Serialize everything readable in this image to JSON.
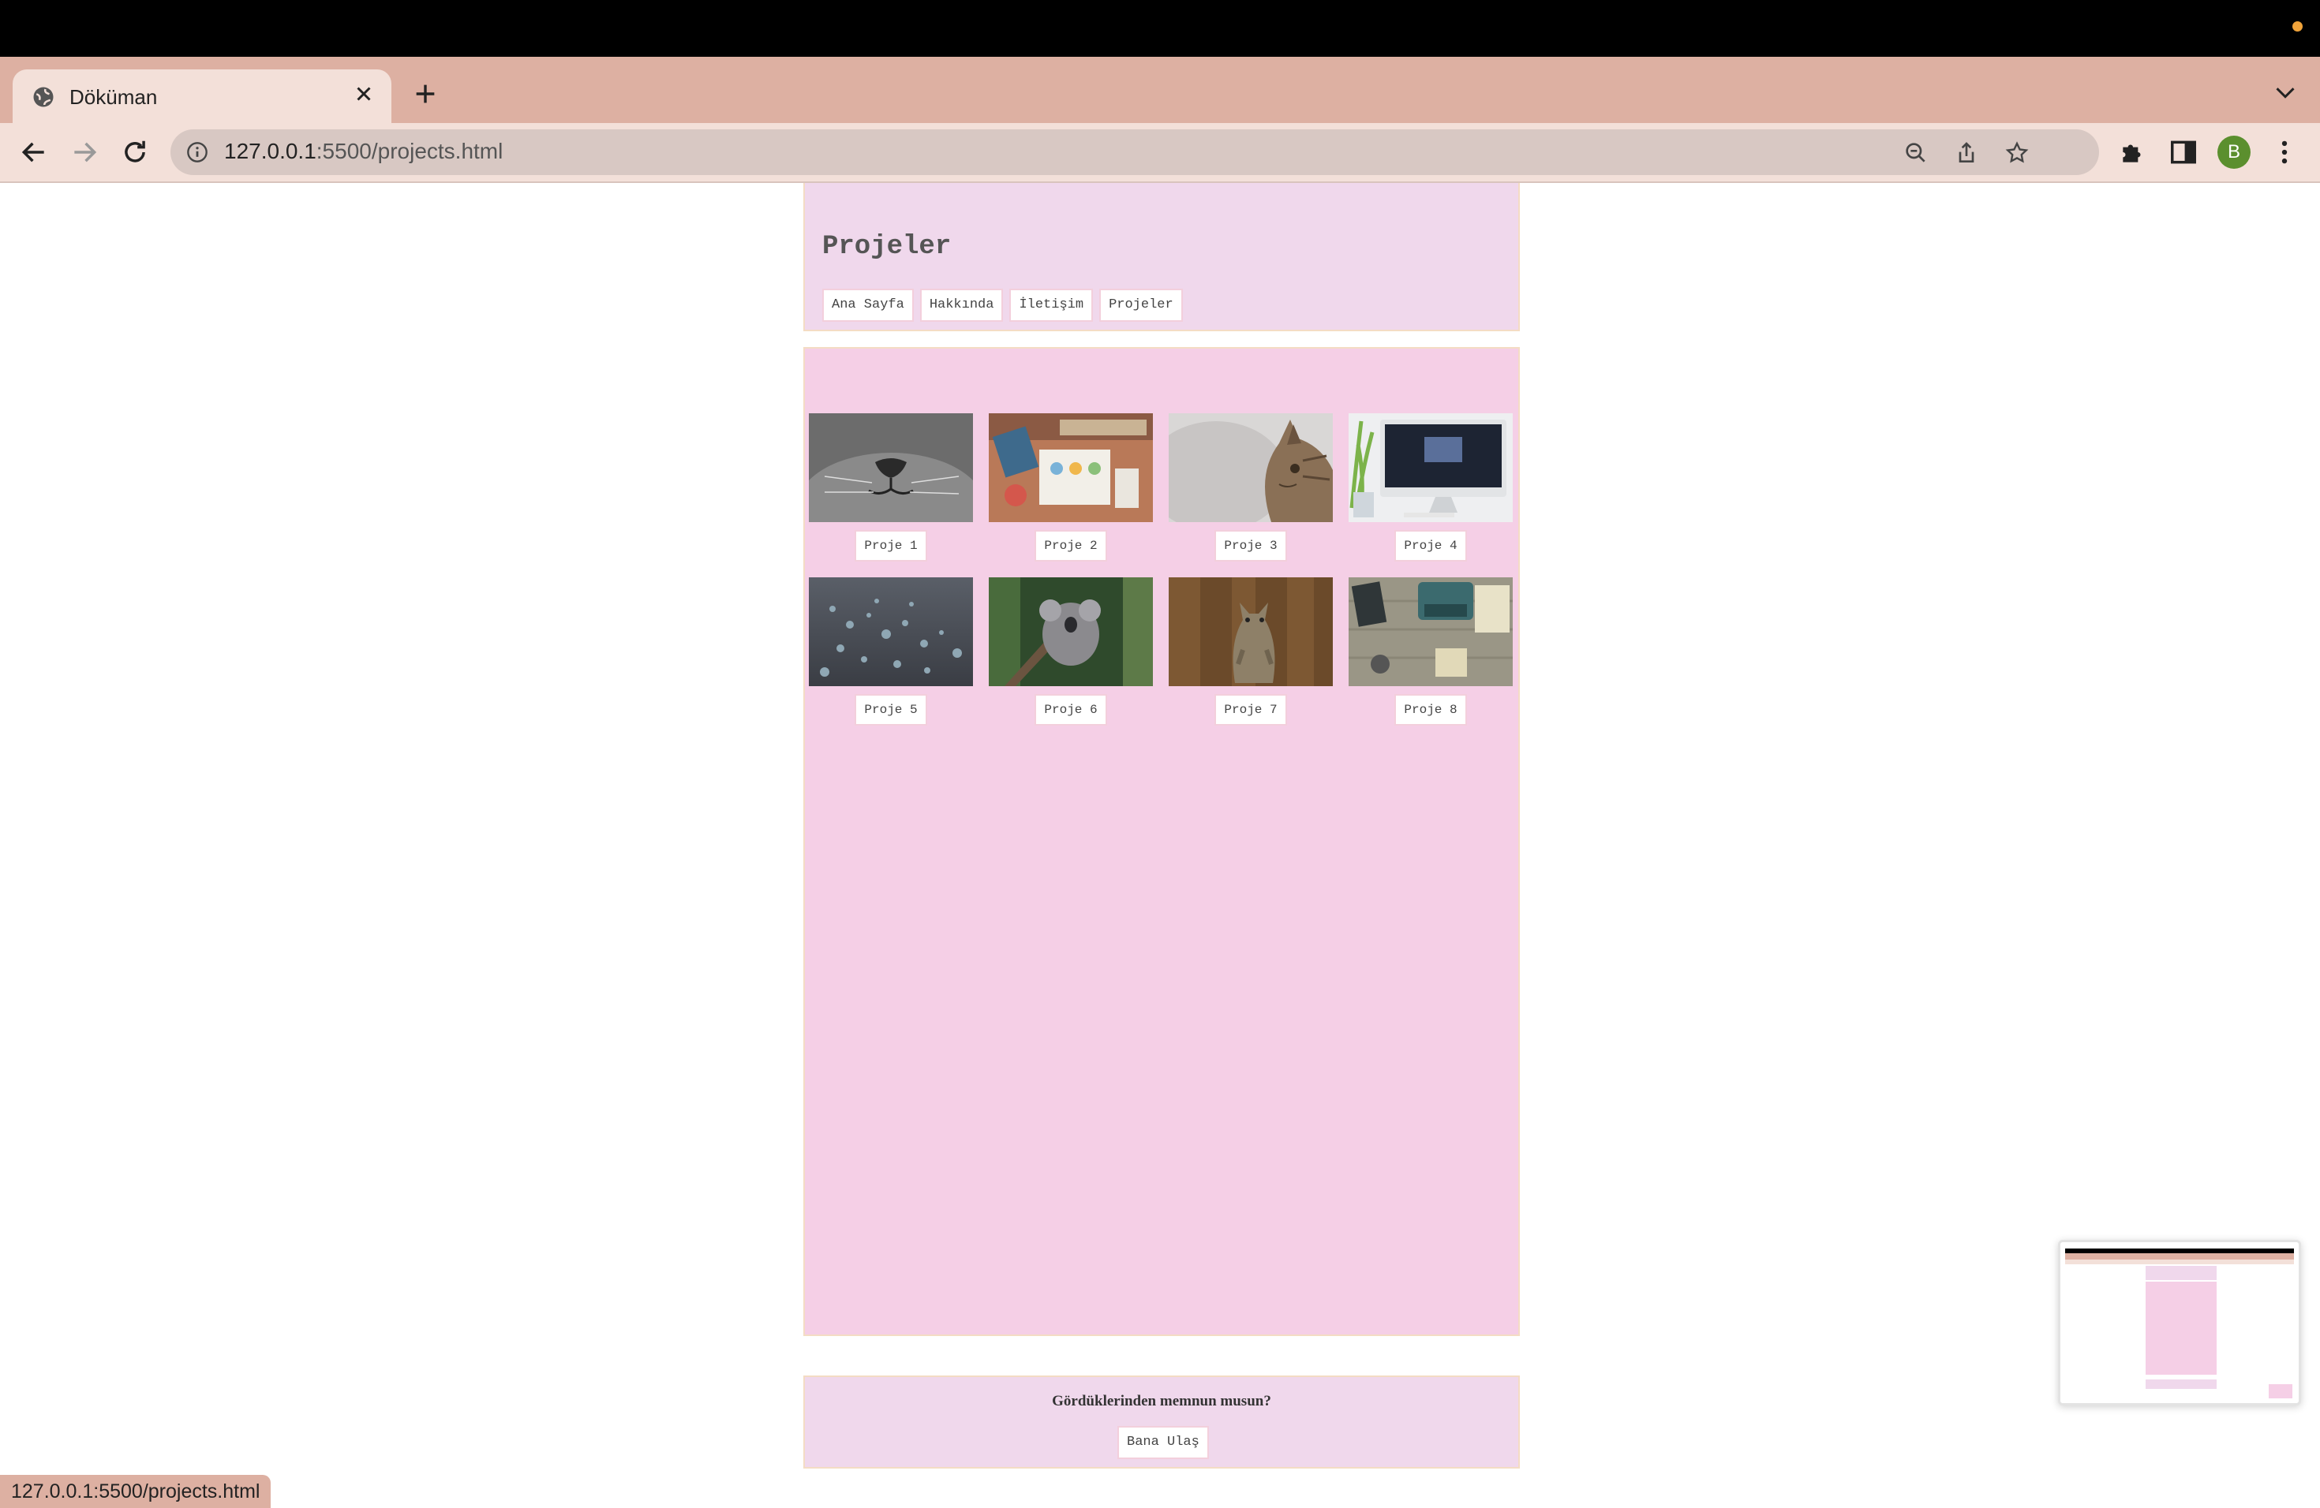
{
  "browser": {
    "tab": {
      "title": "Döküman"
    },
    "url": {
      "host": "127.0.0.1",
      "path": ":5500/projects.html"
    },
    "profile_initial": "B",
    "status_url": "127.0.0.1:5500/projects.html"
  },
  "page": {
    "heading": "Projeler",
    "nav": [
      "Ana Sayfa",
      "Hakkında",
      "İletişim",
      "Projeler"
    ],
    "projects": [
      {
        "label": "Proje 1",
        "image": "cat-nose-closeup"
      },
      {
        "label": "Proje 2",
        "image": "desk-workspace"
      },
      {
        "label": "Proje 3",
        "image": "tabby-cat-profile"
      },
      {
        "label": "Proje 4",
        "image": "imac-desk"
      },
      {
        "label": "Proje 5",
        "image": "water-droplets"
      },
      {
        "label": "Proje 6",
        "image": "koala-tree"
      },
      {
        "label": "Proje 7",
        "image": "standing-cat"
      },
      {
        "label": "Proje 8",
        "image": "typewriter-desk"
      }
    ],
    "footer": {
      "question": "Gördüklerinden memnun musun?",
      "button": "Bana Ulaş"
    }
  },
  "colors": {
    "tab_strip": "#ddb0a2",
    "toolbar": "#f3e0d9",
    "header_bg": "#f0d8ec",
    "main_bg": "#f5cfe6",
    "profile": "#5b8f2e"
  }
}
